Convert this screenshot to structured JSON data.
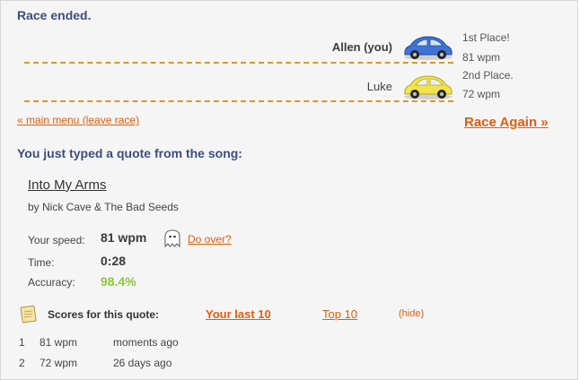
{
  "status_title": "Race ended.",
  "racers": [
    {
      "name": "Allen (you)",
      "place": "1st Place!",
      "speed": "81 wpm",
      "car_color": "#3f74d6",
      "car_icon": "blue-car-icon"
    },
    {
      "name": "Luke",
      "place": "2nd Place.",
      "speed": "72 wpm",
      "car_color": "#f2e34a",
      "car_icon": "yellow-car-icon"
    }
  ],
  "links": {
    "main_menu": "« main menu (leave race)",
    "race_again": "Race Again »"
  },
  "quote": {
    "heading": "You just typed a quote from the song:",
    "song_title": "Into My Arms",
    "artist": "by Nick Cave & The Bad Seeds"
  },
  "stats": {
    "speed_label": "Your speed:",
    "speed_value": "81 wpm",
    "do_over": "Do over?",
    "time_label": "Time:",
    "time_value": "0:28",
    "accuracy_label": "Accuracy:",
    "accuracy_value": "98.4%"
  },
  "scores": {
    "label": "Scores for this quote:",
    "tab_last10": "Your last 10",
    "tab_top10": "Top 10",
    "hide": "(hide)",
    "rows": [
      {
        "rank": "1",
        "speed": "81 wpm",
        "when": "moments ago"
      },
      {
        "rank": "2",
        "speed": "72 wpm",
        "when": "26 days ago"
      }
    ]
  },
  "colors": {
    "accent": "#e55b0c",
    "title": "#3b4e7e",
    "accuracy": "#8cc63f",
    "track": "#d99a14"
  }
}
